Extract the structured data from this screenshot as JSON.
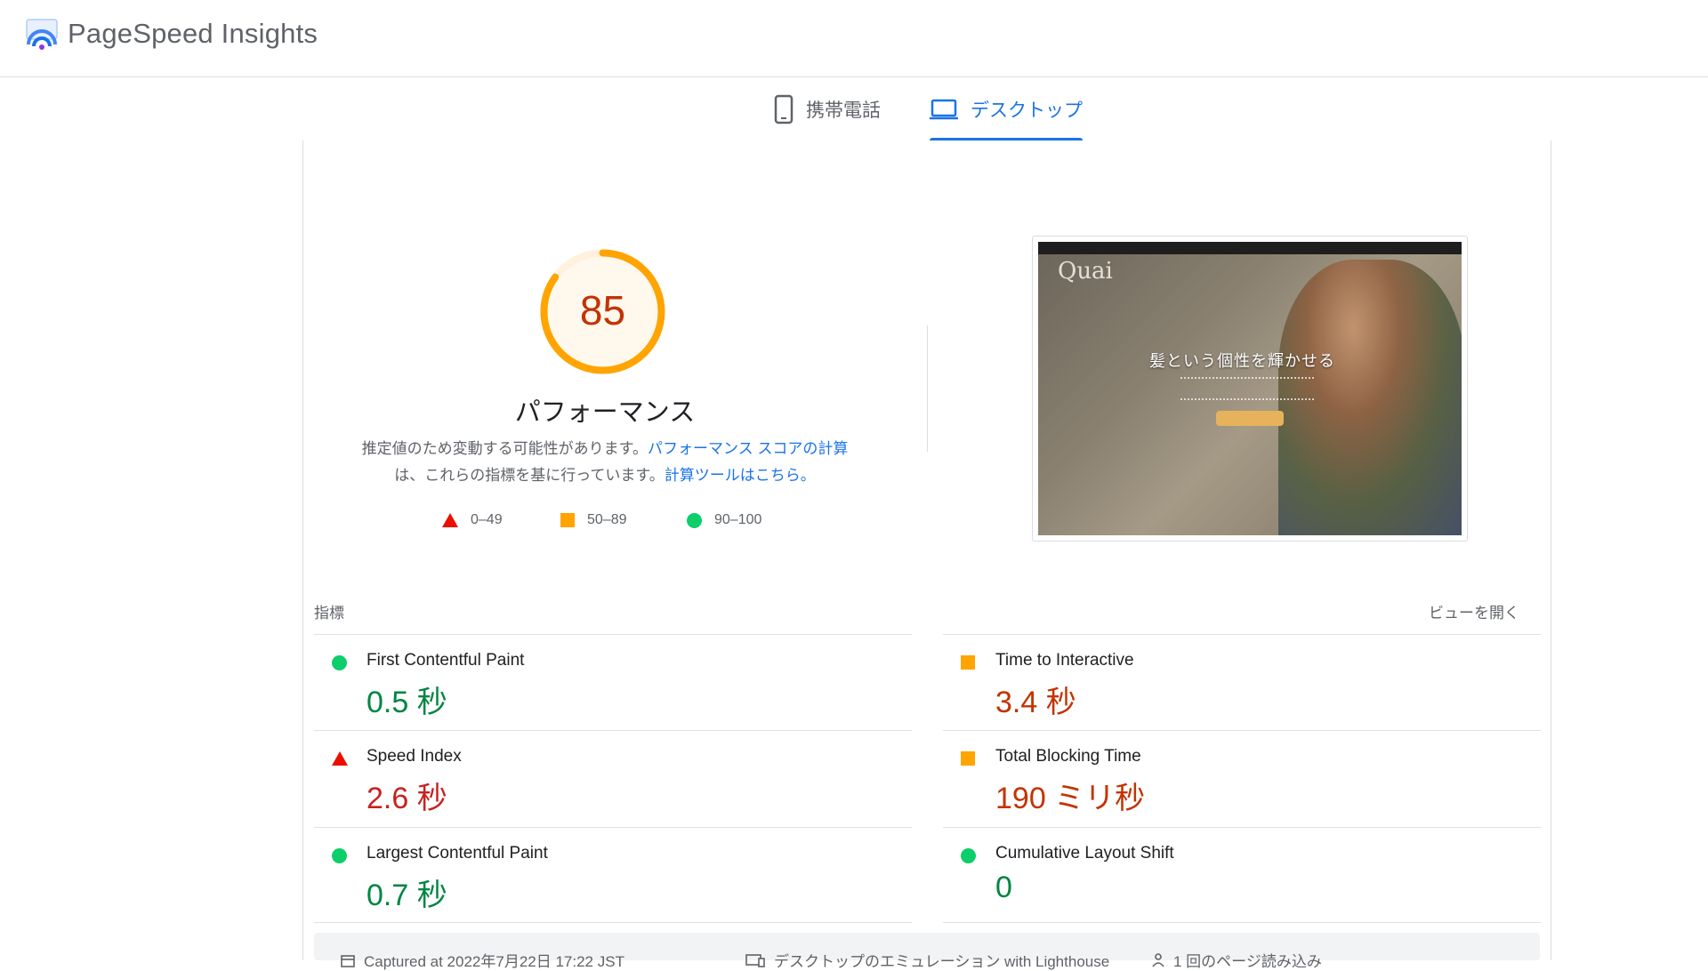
{
  "header": {
    "title": "PageSpeed Insights"
  },
  "tabs": [
    {
      "label": "携帯電話",
      "icon": "phone-icon",
      "active": false
    },
    {
      "label": "デスクトップ",
      "icon": "laptop-icon",
      "active": true
    }
  ],
  "score": {
    "value": "85",
    "title": "パフォーマンス",
    "desc_part1": "推定値のため変動する可能性があります。",
    "link1": "パフォーマンス スコアの計算",
    "desc_part2": "は、これらの指標を基に行っています。",
    "link2": "計算ツールはこちら。",
    "fraction": 0.85,
    "color": "#ffa400"
  },
  "legend": [
    {
      "range": "0–49",
      "shape": "triangle",
      "color": "#eb0f00"
    },
    {
      "range": "50–89",
      "shape": "square",
      "color": "#ffa400"
    },
    {
      "range": "90–100",
      "shape": "circle",
      "color": "#0cce6b"
    }
  ],
  "screenshot": {
    "brand": "Quai",
    "headline": "髪という個性を輝かせる"
  },
  "metrics_section": {
    "label": "指標",
    "expand": "ビューを開く"
  },
  "metrics": [
    {
      "name": "First Contentful Paint",
      "value": "0.5 秒",
      "status": "good"
    },
    {
      "name": "Time to Interactive",
      "value": "3.4 秒",
      "status": "average"
    },
    {
      "name": "Speed Index",
      "value": "2.6 秒",
      "status": "fail"
    },
    {
      "name": "Total Blocking Time",
      "value": "190 ミリ秒",
      "status": "average"
    },
    {
      "name": "Largest Contentful Paint",
      "value": "0.7 秒",
      "status": "good"
    },
    {
      "name": "Cumulative Layout Shift",
      "value": "0",
      "status": "good"
    }
  ],
  "footer": {
    "captured": "Captured at 2022年7月22日 17:22 JST",
    "emulation": "デスクトップのエミュレーション with Lighthouse",
    "loads": "1 回のページ読み込み"
  }
}
